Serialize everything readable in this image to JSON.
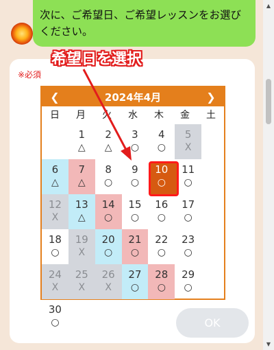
{
  "message": {
    "text": "次に、ご希望日、ご希望レッスンをお選びください。"
  },
  "form": {
    "required_label": "※必須",
    "ok_label": "OK"
  },
  "calendar": {
    "title": "2024年4月",
    "prev": "❮",
    "next": "❯",
    "weekdays": [
      "日",
      "月",
      "火",
      "水",
      "木",
      "金",
      "土"
    ],
    "selected_day": "10",
    "days": [
      {
        "d": "",
        "m": "",
        "t": "empty"
      },
      {
        "d": "1",
        "m": "△",
        "t": "open"
      },
      {
        "d": "2",
        "m": "△",
        "t": "open"
      },
      {
        "d": "3",
        "m": "○",
        "t": "open"
      },
      {
        "d": "4",
        "m": "○",
        "t": "open"
      },
      {
        "d": "5",
        "m": "X",
        "t": "closed"
      },
      {
        "d": "6",
        "m": "△",
        "t": "sat"
      },
      {
        "d": "7",
        "m": "△",
        "t": "sun"
      },
      {
        "d": "8",
        "m": "○",
        "t": "open"
      },
      {
        "d": "9",
        "m": "○",
        "t": "open"
      },
      {
        "d": "10",
        "m": "○",
        "t": "selected"
      },
      {
        "d": "11",
        "m": "○",
        "t": "open"
      },
      {
        "d": "12",
        "m": "X",
        "t": "closed"
      },
      {
        "d": "13",
        "m": "△",
        "t": "sat"
      },
      {
        "d": "14",
        "m": "○",
        "t": "sun"
      },
      {
        "d": "15",
        "m": "○",
        "t": "open"
      },
      {
        "d": "16",
        "m": "○",
        "t": "open"
      },
      {
        "d": "17",
        "m": "○",
        "t": "open"
      },
      {
        "d": "18",
        "m": "○",
        "t": "open"
      },
      {
        "d": "19",
        "m": "X",
        "t": "closed"
      },
      {
        "d": "20",
        "m": "○",
        "t": "sat"
      },
      {
        "d": "21",
        "m": "○",
        "t": "sun"
      },
      {
        "d": "22",
        "m": "○",
        "t": "open"
      },
      {
        "d": "23",
        "m": "○",
        "t": "open"
      },
      {
        "d": "24",
        "m": "X",
        "t": "closed"
      },
      {
        "d": "25",
        "m": "X",
        "t": "closed"
      },
      {
        "d": "26",
        "m": "X",
        "t": "closed"
      },
      {
        "d": "27",
        "m": "○",
        "t": "sat"
      },
      {
        "d": "28",
        "m": "○",
        "t": "sun"
      },
      {
        "d": "29",
        "m": "○",
        "t": "open"
      },
      {
        "d": "30",
        "m": "○",
        "t": "open"
      }
    ]
  },
  "annotation": {
    "text": "希望日を選択"
  },
  "colors": {
    "bubble": "#8de055",
    "calendar_header": "#e47f1c",
    "annotation": "#e21c1c",
    "sunday": "#f2b8b8",
    "saturday": "#c2ecf8",
    "closed": "#d3d6dc",
    "selected": "#d65a11"
  }
}
